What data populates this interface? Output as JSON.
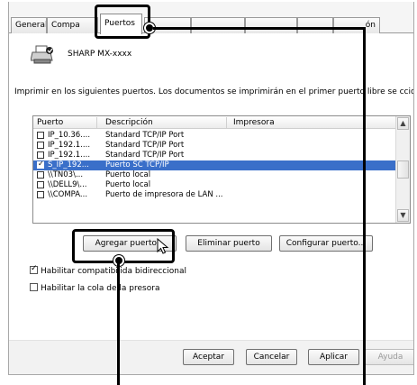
{
  "tabs": [
    {
      "label": "General"
    },
    {
      "label": "Compa"
    },
    {
      "label": "Puertos"
    },
    {
      "label": "ón"
    }
  ],
  "printer": {
    "name": "SHARP MX-xxxx"
  },
  "info_text": "Imprimir en los siguientes puertos. Los documentos se imprimirán en el primer puerto libre se   ccionado.",
  "ports_table": {
    "headers": [
      "Puerto",
      "Descripción",
      "Impresora"
    ],
    "rows": [
      {
        "port": "IP_10.36....",
        "description": "Standard TCP/IP Port",
        "checked": false,
        "selected": false
      },
      {
        "port": "IP_192.1....",
        "description": "Standard TCP/IP Port",
        "checked": false,
        "selected": false
      },
      {
        "port": "IP_192.1....",
        "description": "Standard TCP/IP Port",
        "checked": false,
        "selected": false
      },
      {
        "port": "S_IP_192...",
        "description": "Puerto SC TCP/IP",
        "checked": true,
        "selected": true
      },
      {
        "port": "\\\\TN03\\...",
        "description": "Puerto local",
        "checked": false,
        "selected": false
      },
      {
        "port": "\\\\DELL9\\...",
        "description": "Puerto local",
        "checked": false,
        "selected": false
      },
      {
        "port": "\\\\COMPA...",
        "description": "Puerto de impresora de LAN ...",
        "checked": false,
        "selected": false
      }
    ]
  },
  "port_buttons": {
    "add": "Agregar puerto...",
    "delete": "Eliminar puerto",
    "configure": "Configurar puerto..."
  },
  "options": {
    "bidirectional": {
      "label": "Habilitar compatibilida   bidireccional",
      "checked": true
    },
    "pooling": {
      "label": "Habilitar la cola de la   presora",
      "checked": false
    }
  },
  "dialog_buttons": {
    "ok": "Aceptar",
    "cancel": "Cancelar",
    "apply": "Aplicar",
    "help": "Ayuda"
  },
  "colors": {
    "selection": "#3a6fc9",
    "callout": "#000000"
  }
}
